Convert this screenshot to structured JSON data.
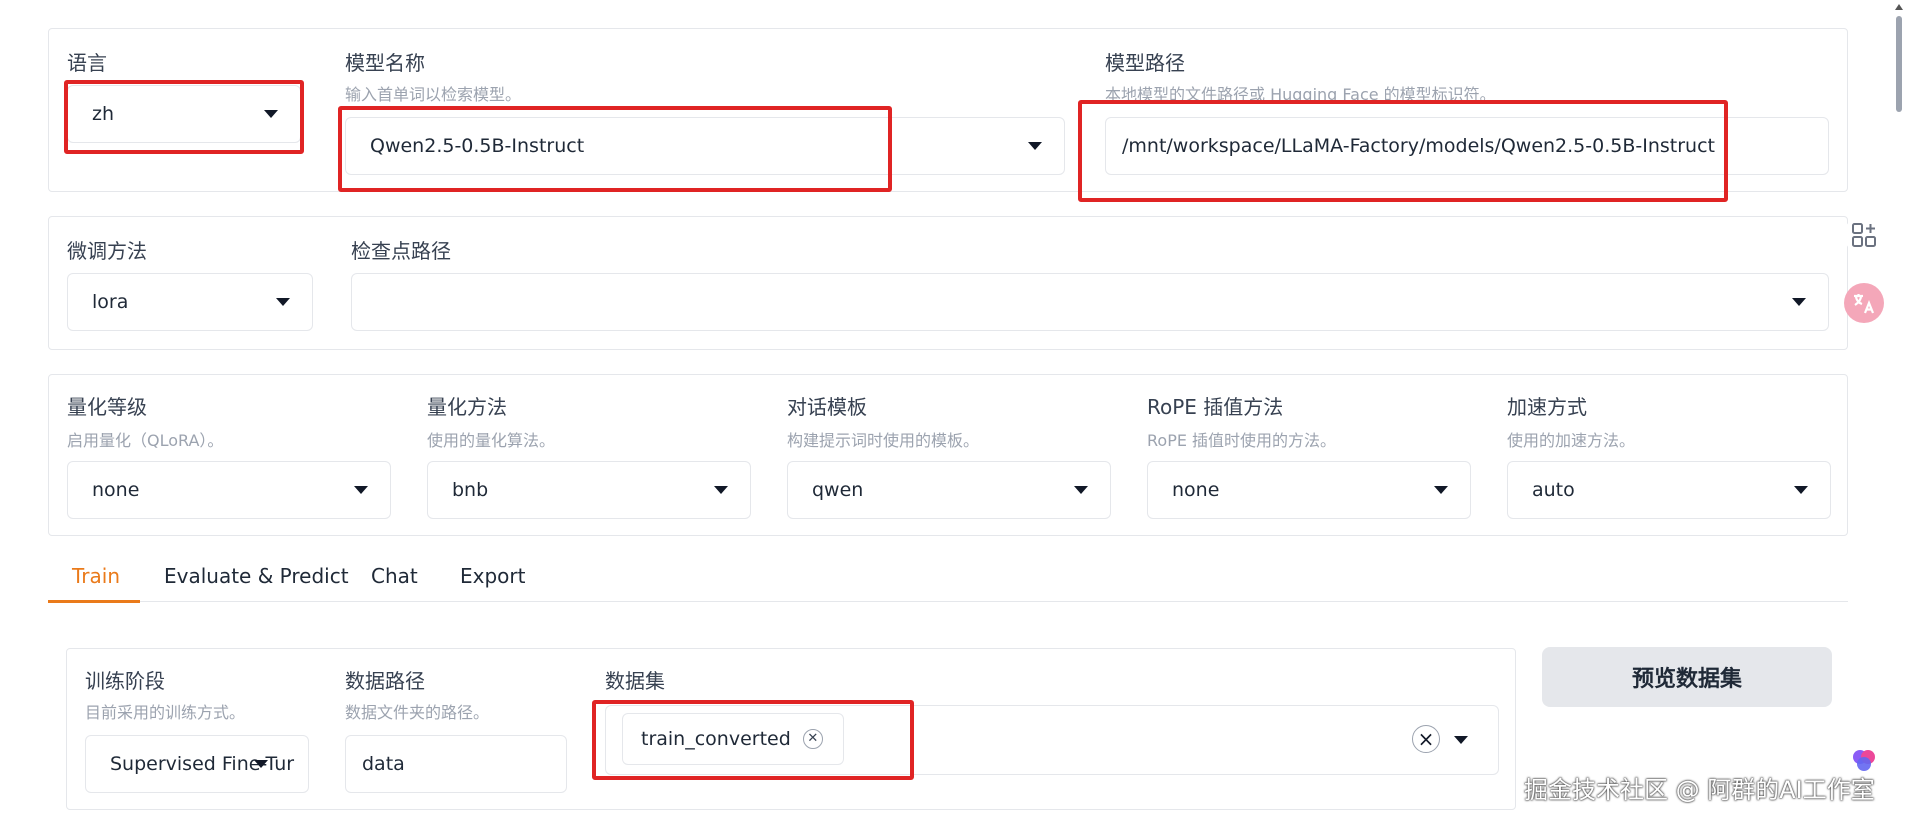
{
  "model_panel": {
    "language": {
      "label": "语言",
      "value": "zh"
    },
    "model_name": {
      "label": "模型名称",
      "hint": "输入首单词以检索模型。",
      "value": "Qwen2.5-0.5B-Instruct"
    },
    "model_path": {
      "label": "模型路径",
      "hint": "本地模型的文件路径或 Hugging Face 的模型标识符。",
      "value": "/mnt/workspace/LLaMA-Factory/models/Qwen2.5-0.5B-Instruct"
    }
  },
  "finetune_panel": {
    "method": {
      "label": "微调方法",
      "value": "lora"
    },
    "checkpoint": {
      "label": "检查点路径",
      "value": ""
    }
  },
  "quant_panel": {
    "quant_bit": {
      "label": "量化等级",
      "hint": "启用量化（QLoRA）。",
      "value": "none"
    },
    "quant_method": {
      "label": "量化方法",
      "hint": "使用的量化算法。",
      "value": "bnb"
    },
    "template": {
      "label": "对话模板",
      "hint": "构建提示词时使用的模板。",
      "value": "qwen"
    },
    "rope": {
      "label": "RoPE 插值方法",
      "hint": "RoPE 插值时使用的方法。",
      "value": "none"
    },
    "booster": {
      "label": "加速方式",
      "hint": "使用的加速方法。",
      "value": "auto"
    }
  },
  "tabs": [
    {
      "label": "Train",
      "active": true
    },
    {
      "label": "Evaluate & Predict",
      "active": false
    },
    {
      "label": "Chat",
      "active": false
    },
    {
      "label": "Export",
      "active": false
    }
  ],
  "train_panel": {
    "stage": {
      "label": "训练阶段",
      "hint": "目前采用的训练方式。",
      "value": "Supervised Fine-Tur"
    },
    "dataset_dir": {
      "label": "数据路径",
      "hint": "数据文件夹的路径。",
      "value": "data"
    },
    "dataset": {
      "label": "数据集",
      "chips": [
        "train_converted"
      ]
    },
    "preview_button": "预览数据集"
  },
  "watermark": "掘金技术社区 @ 阿群的AI工作室",
  "colors": {
    "accent": "#ea7a1a",
    "highlight": "#e02424",
    "button_bg": "#e5e7eb"
  }
}
